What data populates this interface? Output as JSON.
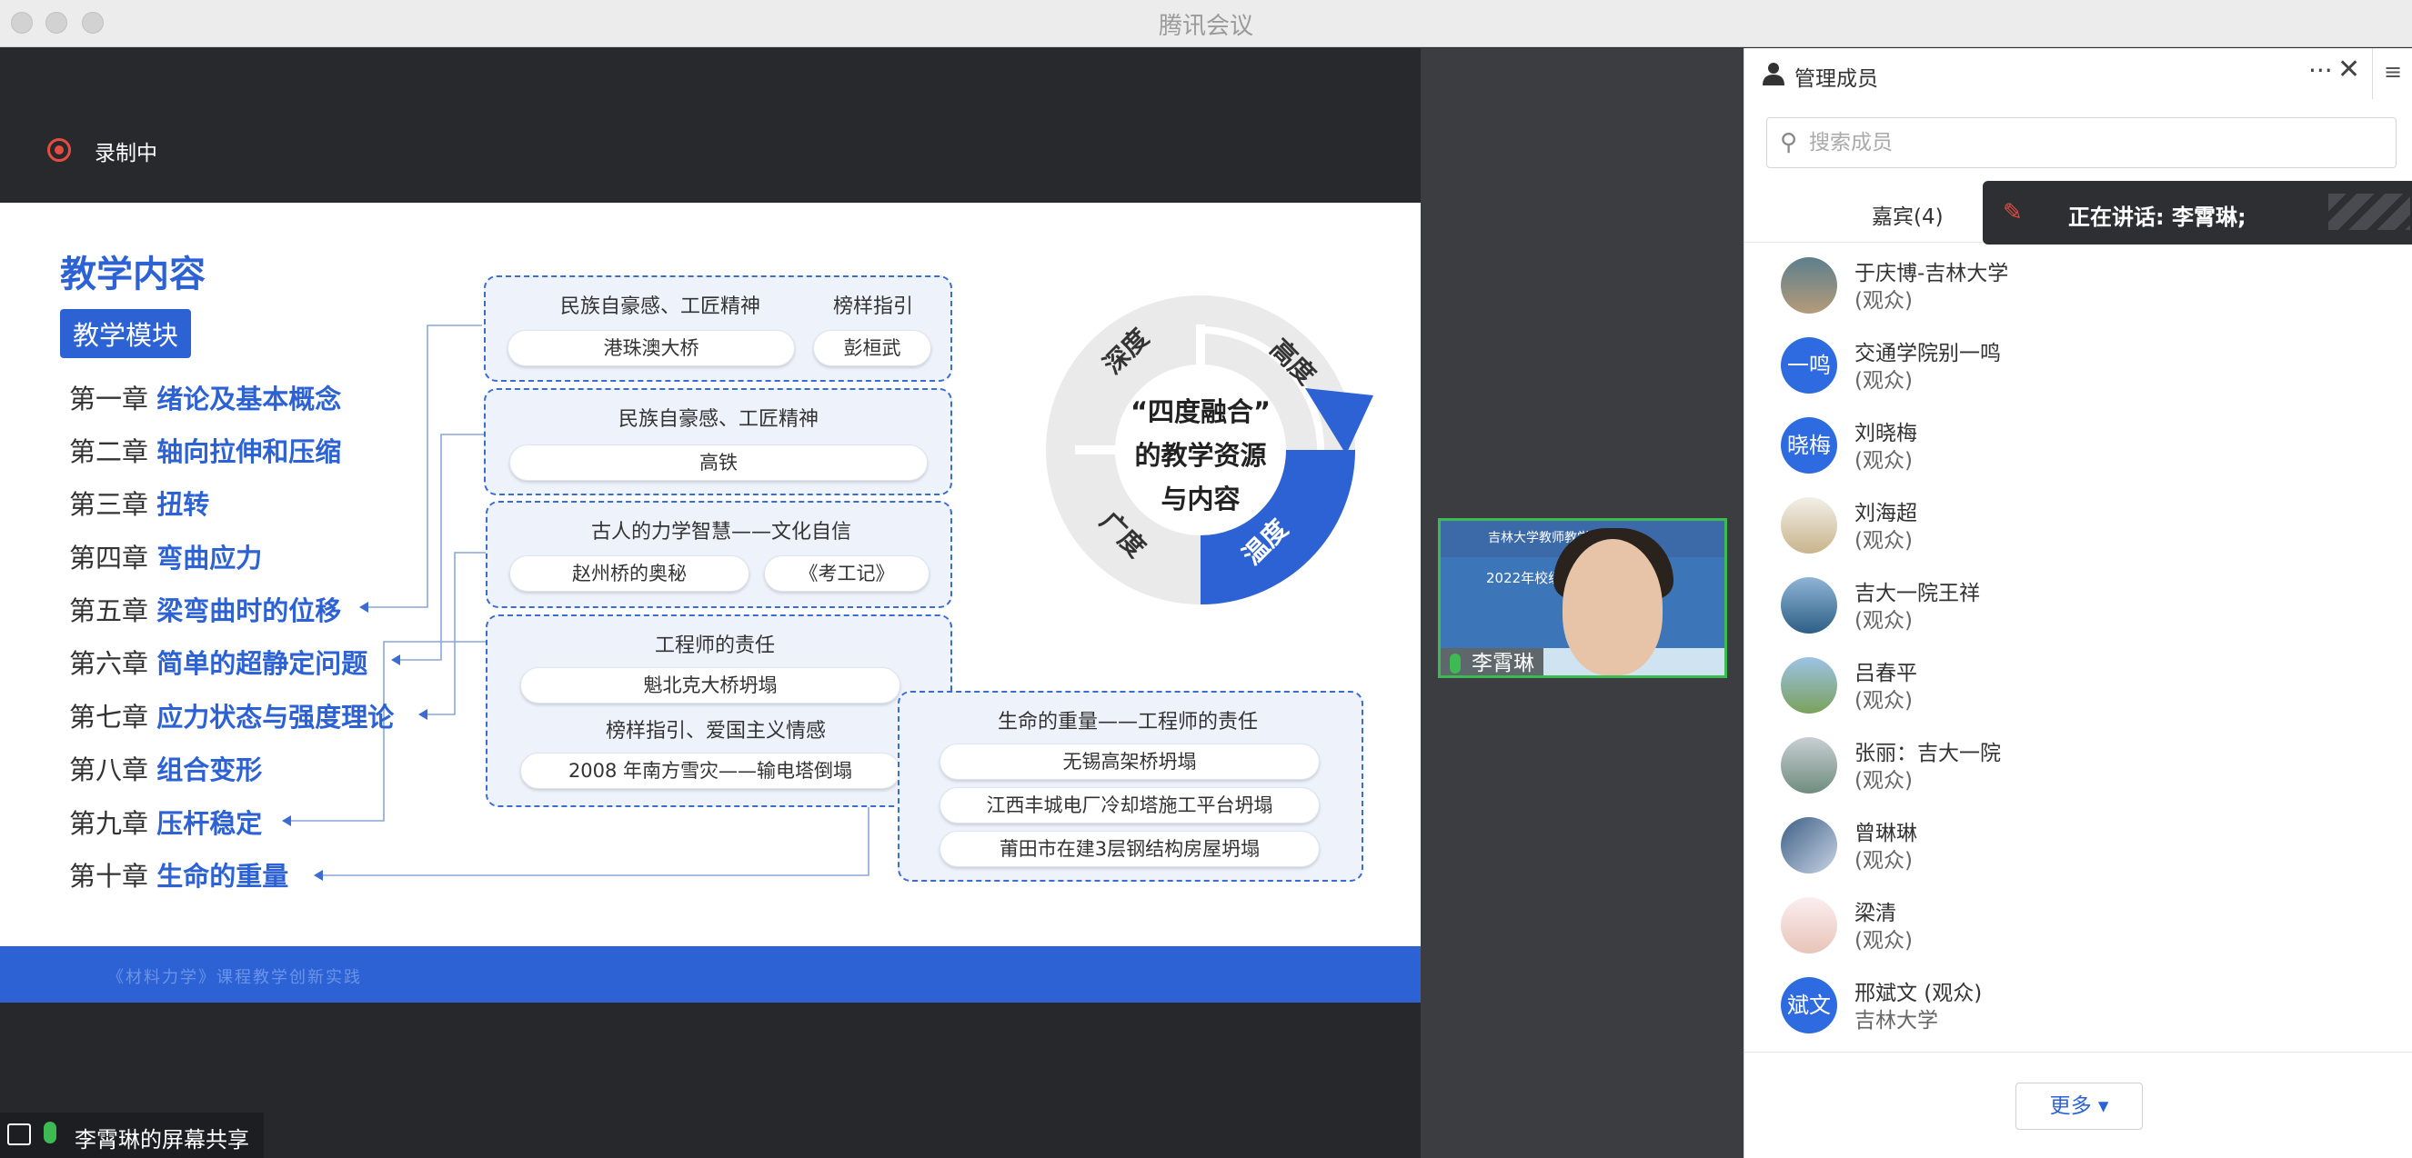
{
  "window": {
    "title": "腾讯会议"
  },
  "recording": {
    "label": "录制中"
  },
  "slide": {
    "heading": "教学内容",
    "module": "教学模块",
    "chapters": [
      {
        "num": "第一章",
        "title": "绪论及基本概念"
      },
      {
        "num": "第二章",
        "title": "轴向拉伸和压缩"
      },
      {
        "num": "第三章",
        "title": "扭转"
      },
      {
        "num": "第四章",
        "title": "弯曲应力"
      },
      {
        "num": "第五章",
        "title": "梁弯曲时的位移"
      },
      {
        "num": "第六章",
        "title": "简单的超静定问题"
      },
      {
        "num": "第七章",
        "title": "应力状态与强度理论"
      },
      {
        "num": "第八章",
        "title": "组合变形"
      },
      {
        "num": "第九章",
        "title": "压杆稳定"
      },
      {
        "num": "第十章",
        "title": "生命的重量"
      }
    ],
    "box1": {
      "label": "民族自豪感、工匠精神",
      "label2": "榜样指引",
      "item": "港珠澳大桥",
      "item2": "彭桓武"
    },
    "box2": {
      "label": "民族自豪感、工匠精神",
      "item": "高铁"
    },
    "box3": {
      "label": "古人的力学智慧——文化自信",
      "item": "赵州桥的奥秘",
      "item2": "《考工记》"
    },
    "box4": {
      "label": "工程师的责任",
      "item": "魁北克大桥坍塌",
      "label2": "榜样指引、爱国主义情感",
      "item2": "2008 年南方雪灾——输电塔倒塌"
    },
    "box5": {
      "label": "生命的重量——工程师的责任",
      "items": [
        "无锡高架桥坍塌",
        "江西丰城电厂冷却塔施工平台坍塌",
        "莆田市在建3层钢结构房屋坍塌"
      ]
    },
    "wheel": {
      "center_lines": [
        "“四度融合”",
        "的教学资源",
        "与内容"
      ],
      "segments": [
        "深度",
        "高度",
        "广度",
        "温度"
      ]
    },
    "footer": "《材料力学》课程教学创新实践"
  },
  "share": {
    "label": "李霄琳的屏幕共享"
  },
  "video": {
    "name": "李霄琳",
    "banner": "吉林大学教师教学发展中心",
    "caption": "2022年校级        培训"
  },
  "panel": {
    "title": "管理成员",
    "more": "···",
    "close": "✕",
    "side": "≡",
    "search_placeholder": "搜索成员",
    "tab": "嘉宾(4)",
    "speaking": "正在讲话: 李霄琳;",
    "members": [
      {
        "name": "于庆博-吉林大学",
        "role": "(观众)",
        "avatar": "photo"
      },
      {
        "name": "交通学院别一鸣",
        "role": "(观众)",
        "avatar": "一鸣"
      },
      {
        "name": "刘晓梅",
        "role": "(观众)",
        "avatar": "晓梅"
      },
      {
        "name": "刘海超",
        "role": "(观众)",
        "avatar": "photo"
      },
      {
        "name": "吉大一院王祥",
        "role": "(观众)",
        "avatar": "photo"
      },
      {
        "name": "吕春平",
        "role": "(观众)",
        "avatar": "photo"
      },
      {
        "name": "张丽：吉大一院",
        "role": "(观众)",
        "avatar": "photo"
      },
      {
        "name": "曾琳琳",
        "role": "(观众)",
        "avatar": "photo"
      },
      {
        "name": "梁清",
        "role": "(观众)",
        "avatar": "photo"
      },
      {
        "name": "邢斌文 (观众)",
        "role": "吉林大学",
        "avatar": "斌文"
      }
    ],
    "more_button": "更多 ▾"
  },
  "colors": {
    "accent": "#2d62d4",
    "speaking": "#3dbb52",
    "record": "#e54d42"
  }
}
